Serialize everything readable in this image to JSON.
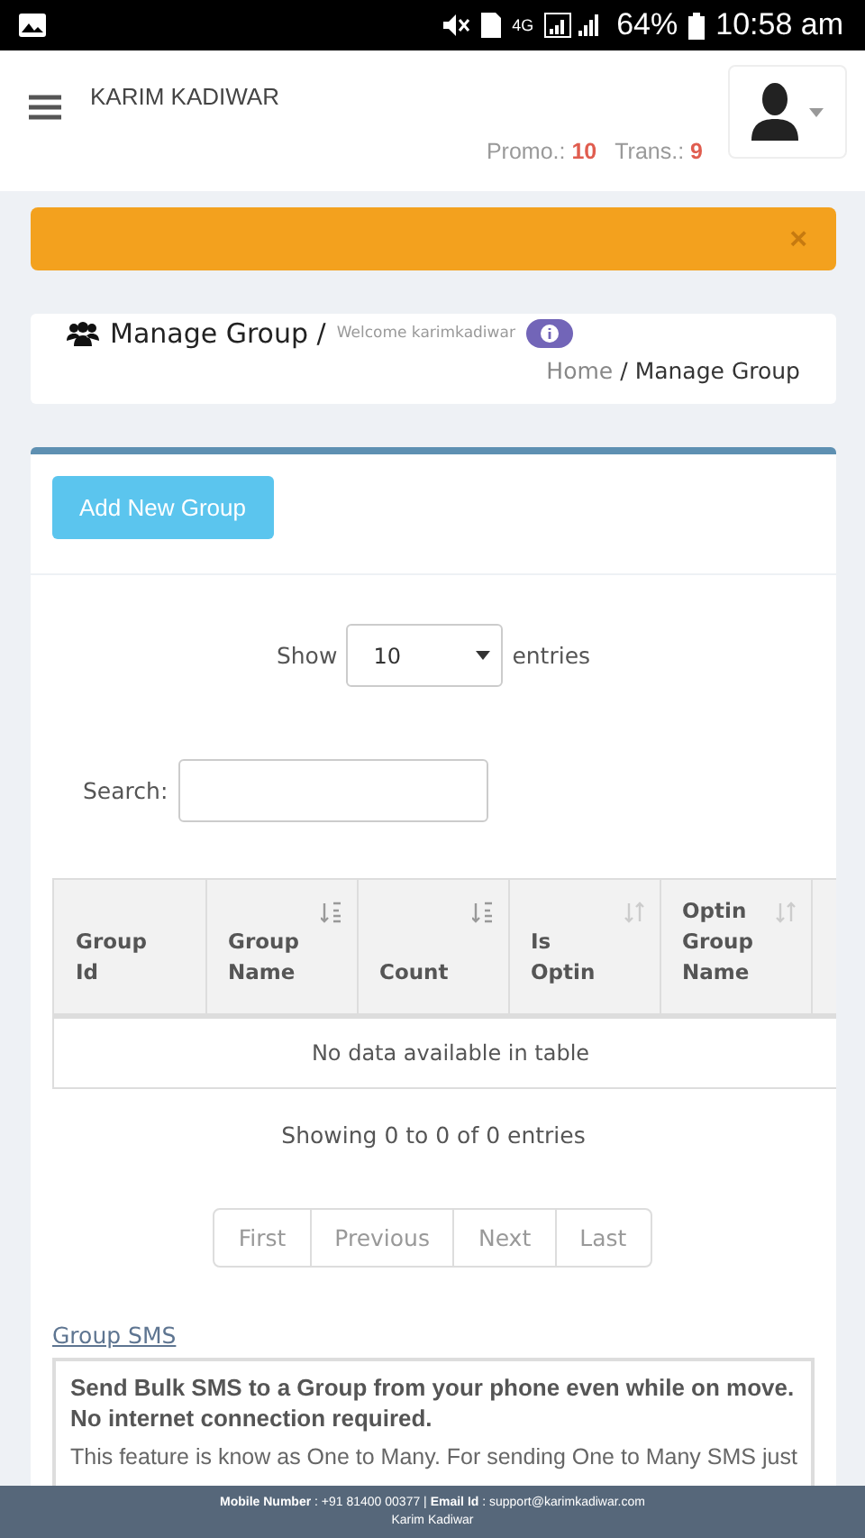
{
  "status_bar": {
    "network": "4G",
    "battery": "64%",
    "time": "10:58 am"
  },
  "header": {
    "user_name": "KARIM KADIWAR",
    "credits": [
      {
        "label": "Promo.:",
        "value": "10"
      },
      {
        "label": "Trans.:",
        "value": "9"
      }
    ]
  },
  "alert": {
    "close": "×"
  },
  "page_title": {
    "title": "Manage Group /",
    "subtitle": "Welcome karimkadiwar",
    "separator": "/",
    "breadcrumb": [
      {
        "label": "Home",
        "kind": "link"
      },
      {
        "label": "Manage Group",
        "kind": "current"
      }
    ]
  },
  "add_button": "Add New Group",
  "length_menu": {
    "prefix": "Show",
    "value": "10",
    "suffix": "entries"
  },
  "search": {
    "label": "Search:"
  },
  "table": {
    "columns": [
      {
        "label": "Group Id",
        "kind": "plain"
      },
      {
        "label": "Group Name",
        "kind": "sort_alpha"
      },
      {
        "label": "Count",
        "kind": "sort_alpha"
      },
      {
        "label": "Is Optin",
        "kind": "sort_both"
      },
      {
        "label": "Optin Group Name",
        "kind": "sort_both"
      }
    ],
    "empty": "No data available in table"
  },
  "info": "Showing 0 to 0 of 0 entries",
  "pagination": [
    {
      "label": "First",
      "disabled": true
    },
    {
      "label": "Previous",
      "disabled": true
    },
    {
      "label": "Next",
      "disabled": true
    },
    {
      "label": "Last",
      "disabled": true
    }
  ],
  "help": {
    "link": "Group SMS",
    "lead": "Send Bulk SMS to a Group from your phone even while on move. No internet connection required.",
    "body": "This feature is know as One to Many. For sending One to Many SMS just"
  },
  "footer": {
    "contact": "**Mobile Number** : +91 81400 00377 | **Email Id** : support@karimkadiwar.com",
    "name": "Karim Kadiwar"
  }
}
